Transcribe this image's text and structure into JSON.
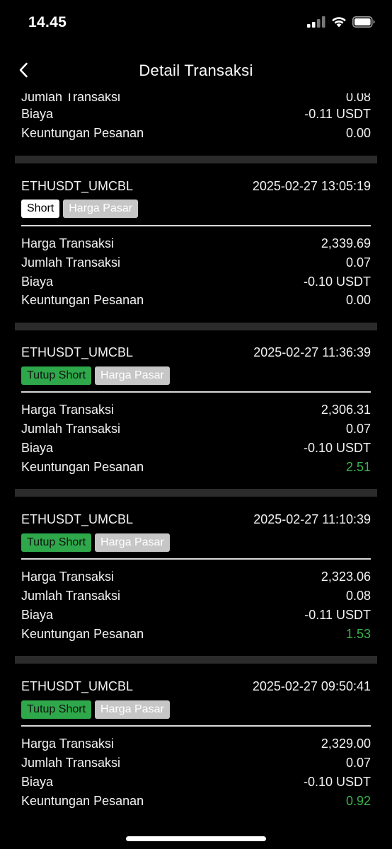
{
  "status_bar": {
    "time": "14.45"
  },
  "nav": {
    "title": "Detail Transaksi"
  },
  "partial_card": {
    "cut_value": "0.08",
    "rows": [
      {
        "label": "Biaya",
        "value": "-0.11 USDT"
      },
      {
        "label": "Keuntungan Pesanan",
        "value": "0.00"
      }
    ]
  },
  "cards": [
    {
      "symbol": "ETHUSDT_UMCBL",
      "datetime": "2025-02-27 13:05:19",
      "side_tag": "Short",
      "type_tag": "Harga Pasar",
      "rows": [
        {
          "label": "Harga Transaksi",
          "value": "2,339.69"
        },
        {
          "label": "Jumlah Transaksi",
          "value": "0.07"
        },
        {
          "label": "Biaya",
          "value": "-0.10 USDT"
        },
        {
          "label": "Keuntungan Pesanan",
          "value": "0.00"
        }
      ]
    },
    {
      "symbol": "ETHUSDT_UMCBL",
      "datetime": "2025-02-27 11:36:39",
      "side_tag": "Tutup Short",
      "type_tag": "Harga Pasar",
      "rows": [
        {
          "label": "Harga Transaksi",
          "value": "2,306.31"
        },
        {
          "label": "Jumlah Transaksi",
          "value": "0.07"
        },
        {
          "label": "Biaya",
          "value": "-0.10 USDT"
        },
        {
          "label": "Keuntungan Pesanan",
          "value": "2.51"
        }
      ]
    },
    {
      "symbol": "ETHUSDT_UMCBL",
      "datetime": "2025-02-27 11:10:39",
      "side_tag": "Tutup Short",
      "type_tag": "Harga Pasar",
      "rows": [
        {
          "label": "Harga Transaksi",
          "value": "2,323.06"
        },
        {
          "label": "Jumlah Transaksi",
          "value": "0.08"
        },
        {
          "label": "Biaya",
          "value": "-0.11 USDT"
        },
        {
          "label": "Keuntungan Pesanan",
          "value": "1.53"
        }
      ]
    },
    {
      "symbol": "ETHUSDT_UMCBL",
      "datetime": "2025-02-27 09:50:41",
      "side_tag": "Tutup Short",
      "type_tag": "Harga Pasar",
      "rows": [
        {
          "label": "Harga Transaksi",
          "value": "2,329.00"
        },
        {
          "label": "Jumlah Transaksi",
          "value": "0.07"
        },
        {
          "label": "Biaya",
          "value": "-0.10 USDT"
        },
        {
          "label": "Keuntungan Pesanan",
          "value": "0.92"
        }
      ]
    }
  ],
  "colors": {
    "profit": "#39b54a",
    "tag_green": "#2ea84a",
    "tag_gray": "#c6c6c6",
    "separator": "#2b2b2b"
  },
  "icons": {
    "back": "chevron-left-icon",
    "signal": "cellular-signal-icon",
    "wifi": "wifi-icon",
    "battery": "battery-icon"
  }
}
